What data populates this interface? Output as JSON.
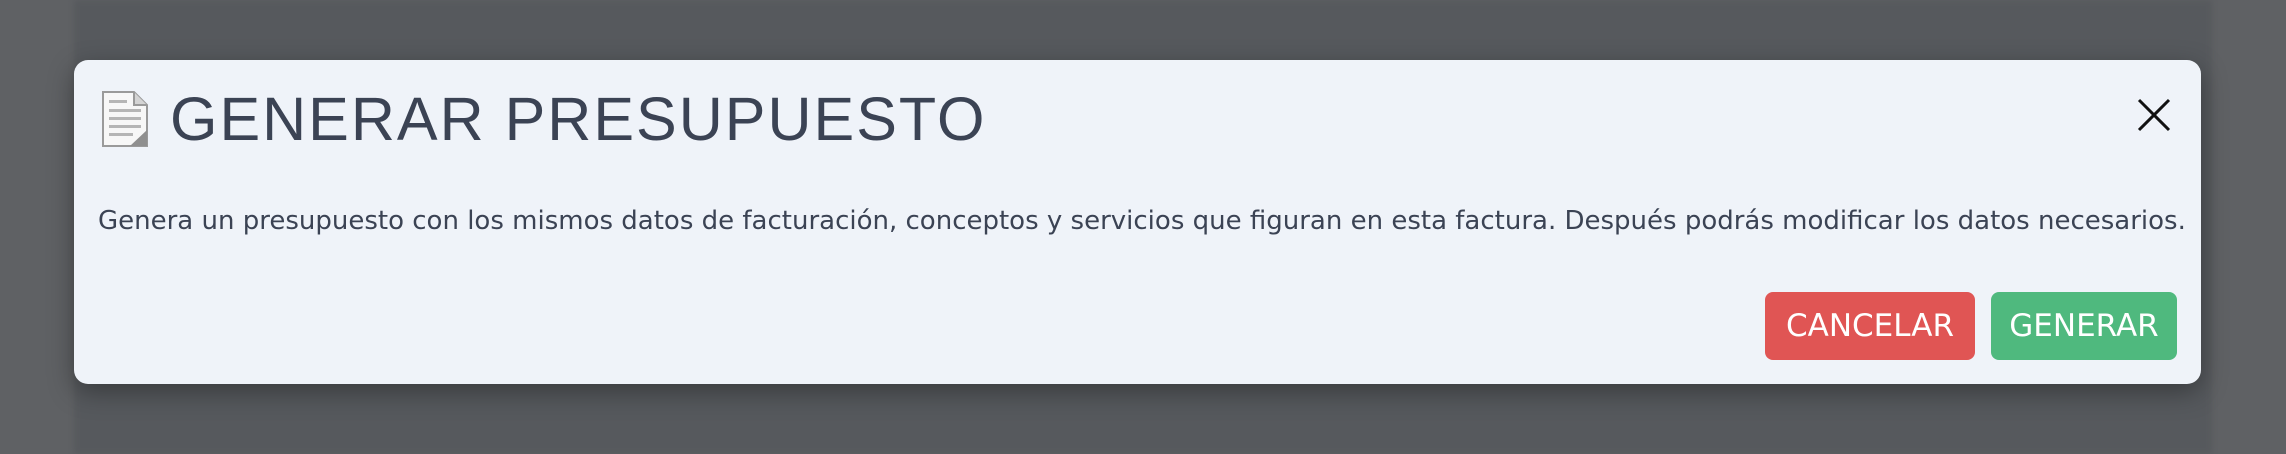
{
  "modal": {
    "title": "GENERAR PRESUPUESTO",
    "icon": "document-icon",
    "close_icon": "close-icon",
    "message": "Genera un presupuesto con los mismos datos de facturación, conceptos y servicios que figuran en esta factura. Después podrás modificar los datos necesarios.",
    "buttons": {
      "cancel_label": "CANCELAR",
      "generate_label": "GENERAR"
    },
    "colors": {
      "background": "#eff3f9",
      "title": "#3b4354",
      "cancel": "#e05554",
      "generate": "#4fb97e",
      "overlay": "#5f6164"
    }
  }
}
